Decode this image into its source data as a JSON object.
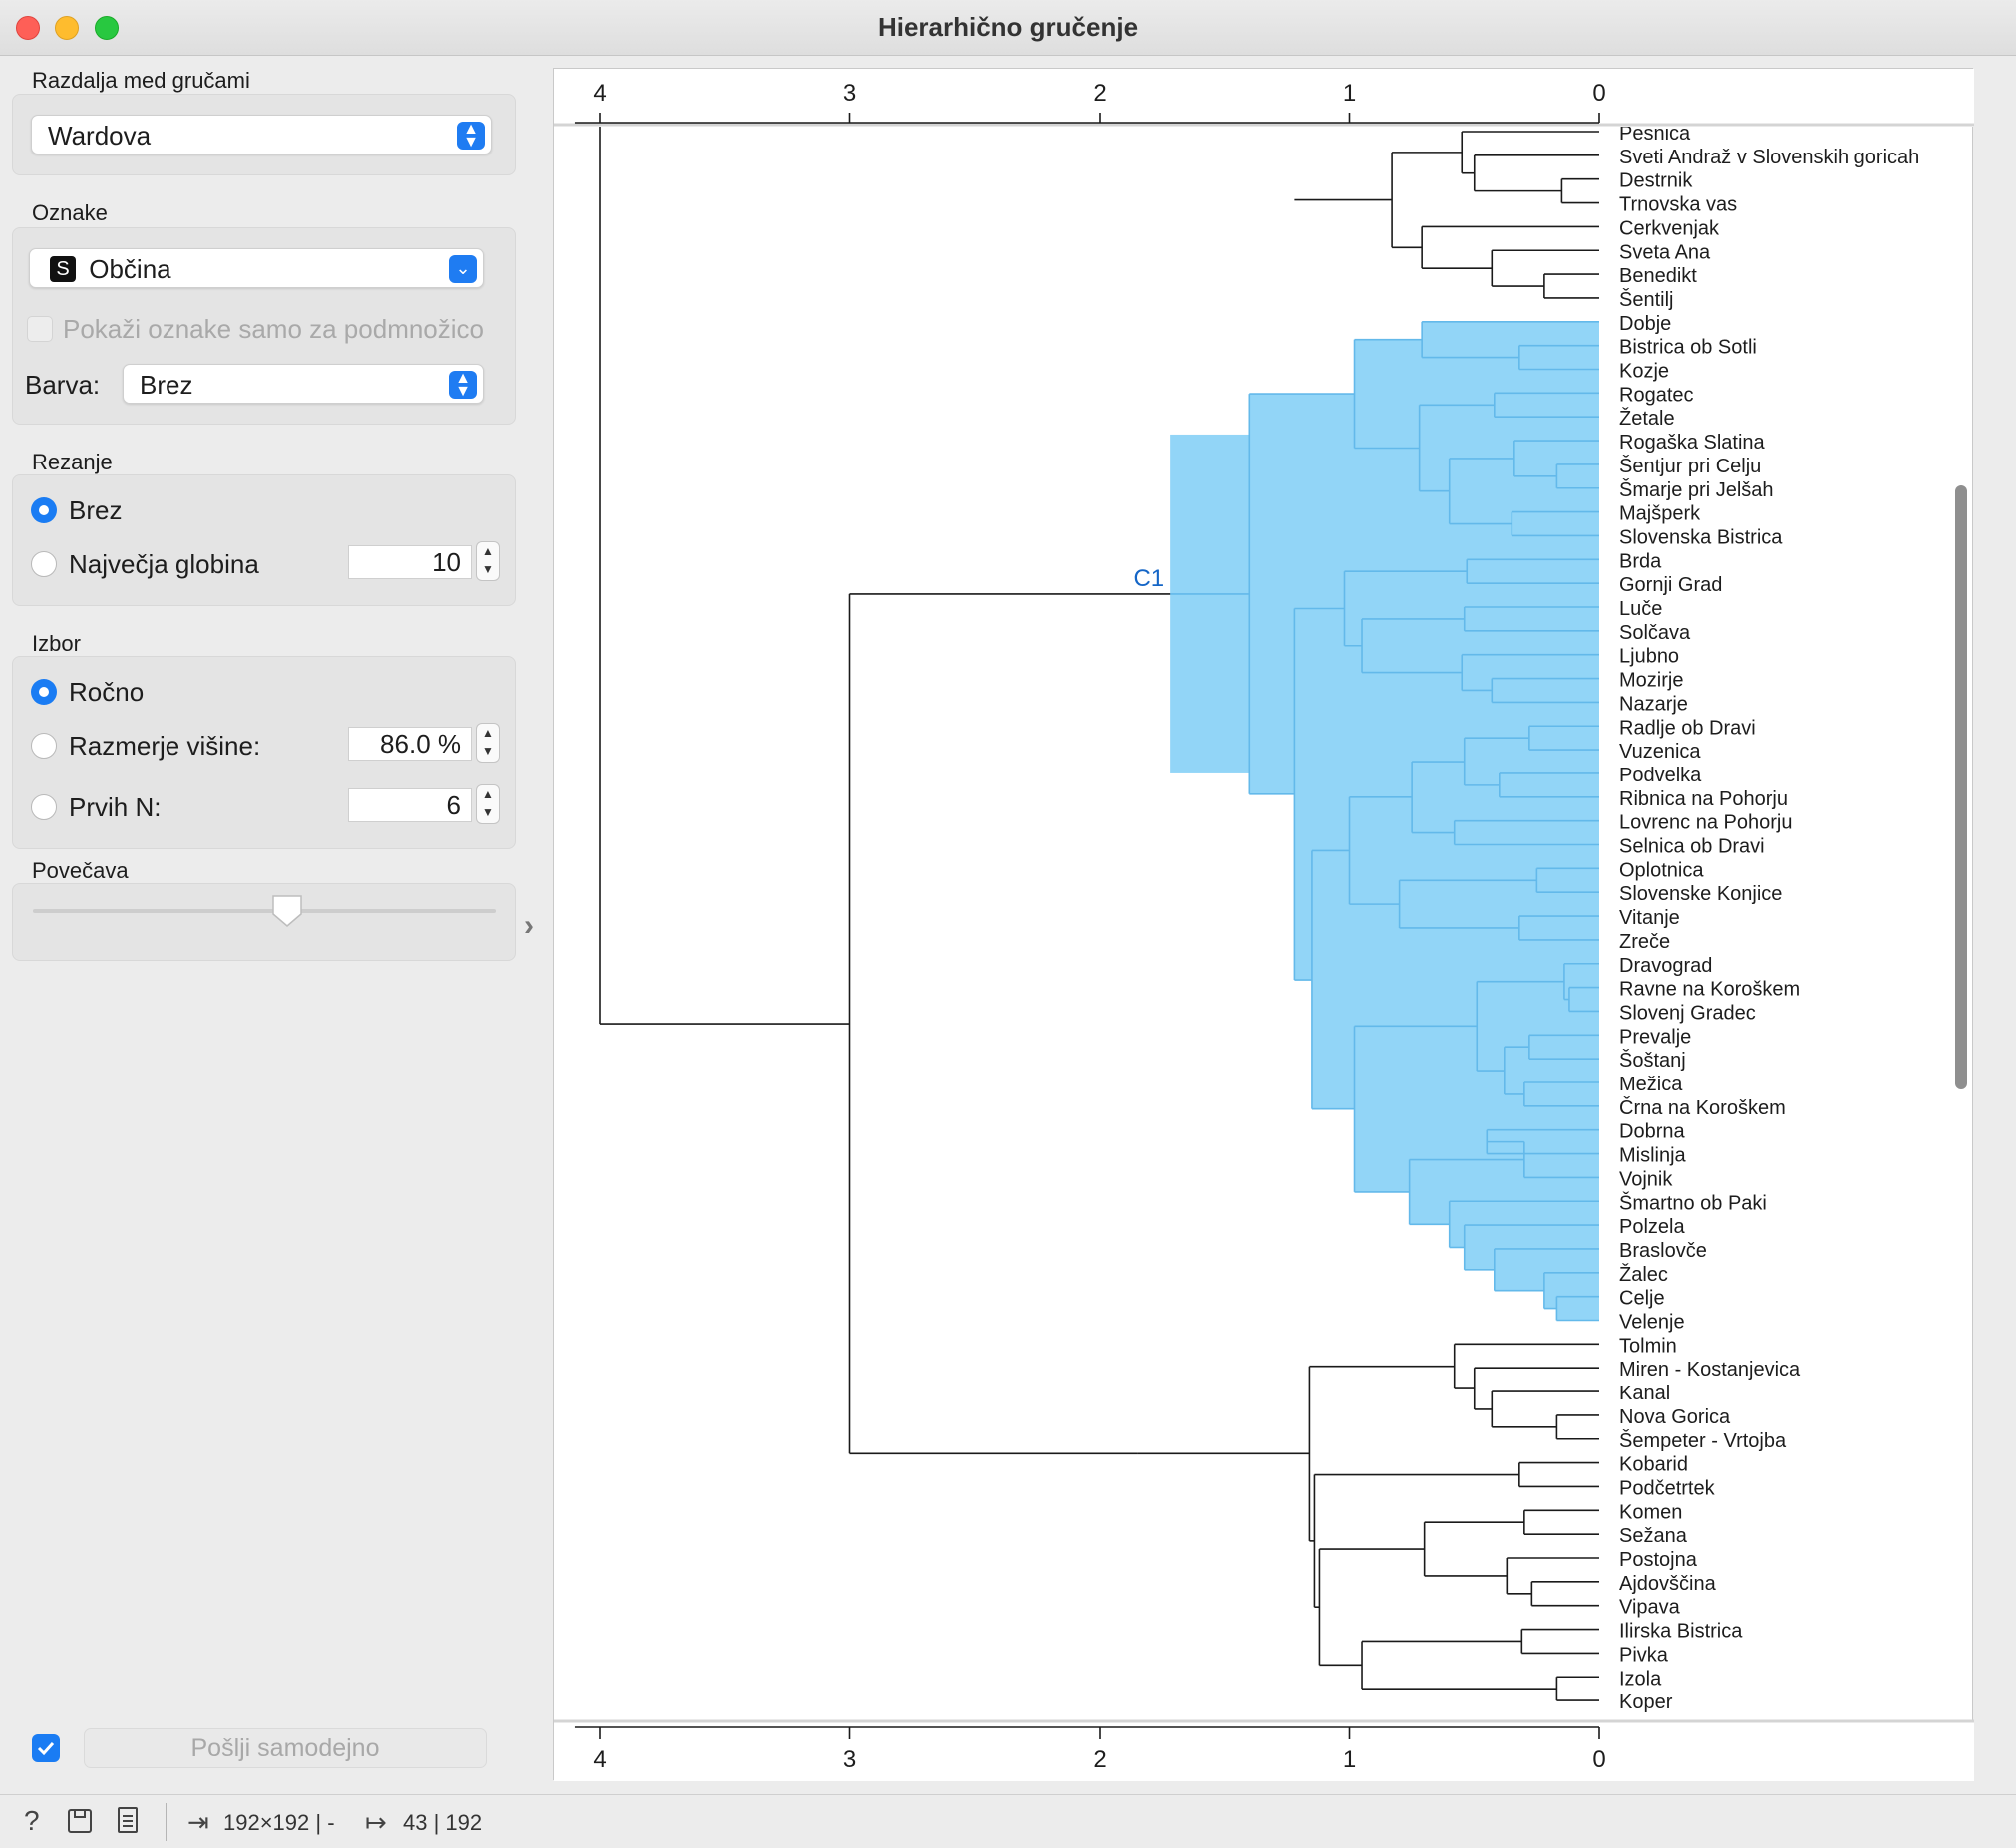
{
  "window": {
    "title": "Hierarhično gručenje"
  },
  "linkage": {
    "label": "Razdalja med gručami",
    "value": "Wardova"
  },
  "annotations": {
    "label": "Oznake",
    "value": "Občina",
    "type_badge": "S",
    "subset_checkbox": "Pokaži oznake samo za podmnožico",
    "color_label": "Barva:",
    "color_value": "Brez"
  },
  "pruning": {
    "label": "Rezanje",
    "option_none": "Brez",
    "option_depth": "Največja globina",
    "depth_value": "10",
    "selected": "Brez"
  },
  "selection": {
    "label": "Izbor",
    "option_manual": "Ročno",
    "option_height": "Razmerje višine:",
    "height_value": "86.0 %",
    "option_topn": "Prvih N:",
    "topn_value": "6",
    "selected": "Ročno"
  },
  "zoom": {
    "label": "Povečava",
    "level": 0.55
  },
  "send": {
    "label": "Pošlji samodejno",
    "auto": true
  },
  "status": {
    "input": "192×192 | -",
    "output": "43 | 192"
  },
  "colors": {
    "selection_fill": "#92d5f7",
    "selection_line": "#63b9ea",
    "accent": "#1a7cf3",
    "cluster_label": "#1566c7"
  },
  "chart_data": {
    "type": "dendrogram",
    "axis_ticks": [
      "4",
      "3",
      "2",
      "1",
      "0"
    ],
    "xlim": [
      4.1,
      0
    ],
    "selected_cluster_label": "C1",
    "leaves": [
      "Pesnica",
      "Sveti Andraž v Slovenskih goricah",
      "Destrnik",
      "Trnovska vas",
      "Cerkvenjak",
      "Sveta Ana",
      "Benedikt",
      "Šentilj",
      "Dobje",
      "Bistrica ob Sotli",
      "Kozje",
      "Rogatec",
      "Žetale",
      "Rogaška Slatina",
      "Šentjur pri Celju",
      "Šmarje pri Jelšah",
      "Majšperk",
      "Slovenska Bistrica",
      "Brda",
      "Gornji Grad",
      "Luče",
      "Solčava",
      "Ljubno",
      "Mozirje",
      "Nazarje",
      "Radlje ob Dravi",
      "Vuzenica",
      "Podvelka",
      "Ribnica na Pohorju",
      "Lovrenc na Pohorju",
      "Selnica ob Dravi",
      "Oplotnica",
      "Slovenske Konjice",
      "Vitanje",
      "Zreče",
      "Dravograd",
      "Ravne na Koroškem",
      "Slovenj Gradec",
      "Prevalje",
      "Šoštanj",
      "Mežica",
      "Črna na Koroškem",
      "Dobrna",
      "Mislinja",
      "Vojnik",
      "Šmartno ob Paki",
      "Polzela",
      "Braslovče",
      "Žalec",
      "Celje",
      "Velenje",
      "Tolmin",
      "Miren - Kostanjevica",
      "Kanal",
      "Nova Gorica",
      "Šempeter - Vrtojba",
      "Kobarid",
      "Podčetrtek",
      "Komen",
      "Sežana",
      "Postojna",
      "Ajdovščina",
      "Vipava",
      "Ilirska Bistrica",
      "Pivka",
      "Izola",
      "Koper"
    ],
    "selected_range": [
      "Dobje",
      "Velenje"
    ]
  }
}
